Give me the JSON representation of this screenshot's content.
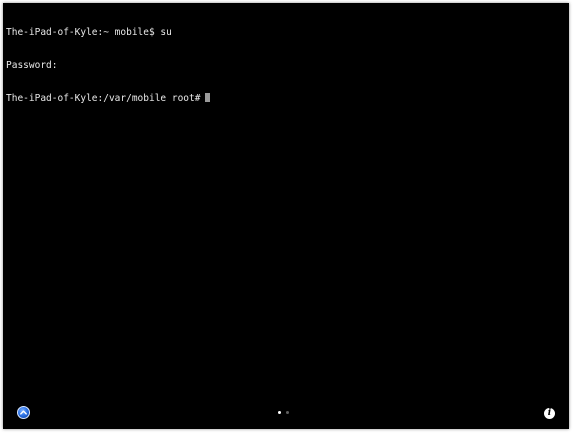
{
  "terminal": {
    "lines": [
      "The-iPad-of-Kyle:~ mobile$ su",
      "Password:",
      "The-iPad-of-Kyle:/var/mobile root#"
    ]
  },
  "controls": {
    "up_icon": "chevron-up-icon",
    "info_icon": "info-icon",
    "info_glyph": "i"
  },
  "pager": {
    "page_count": 2,
    "current_page": 1
  },
  "colors": {
    "background": "#000000",
    "text": "#e9e9e9",
    "cursor": "#9a9a9a",
    "accent_blue": "#2f75e8"
  }
}
